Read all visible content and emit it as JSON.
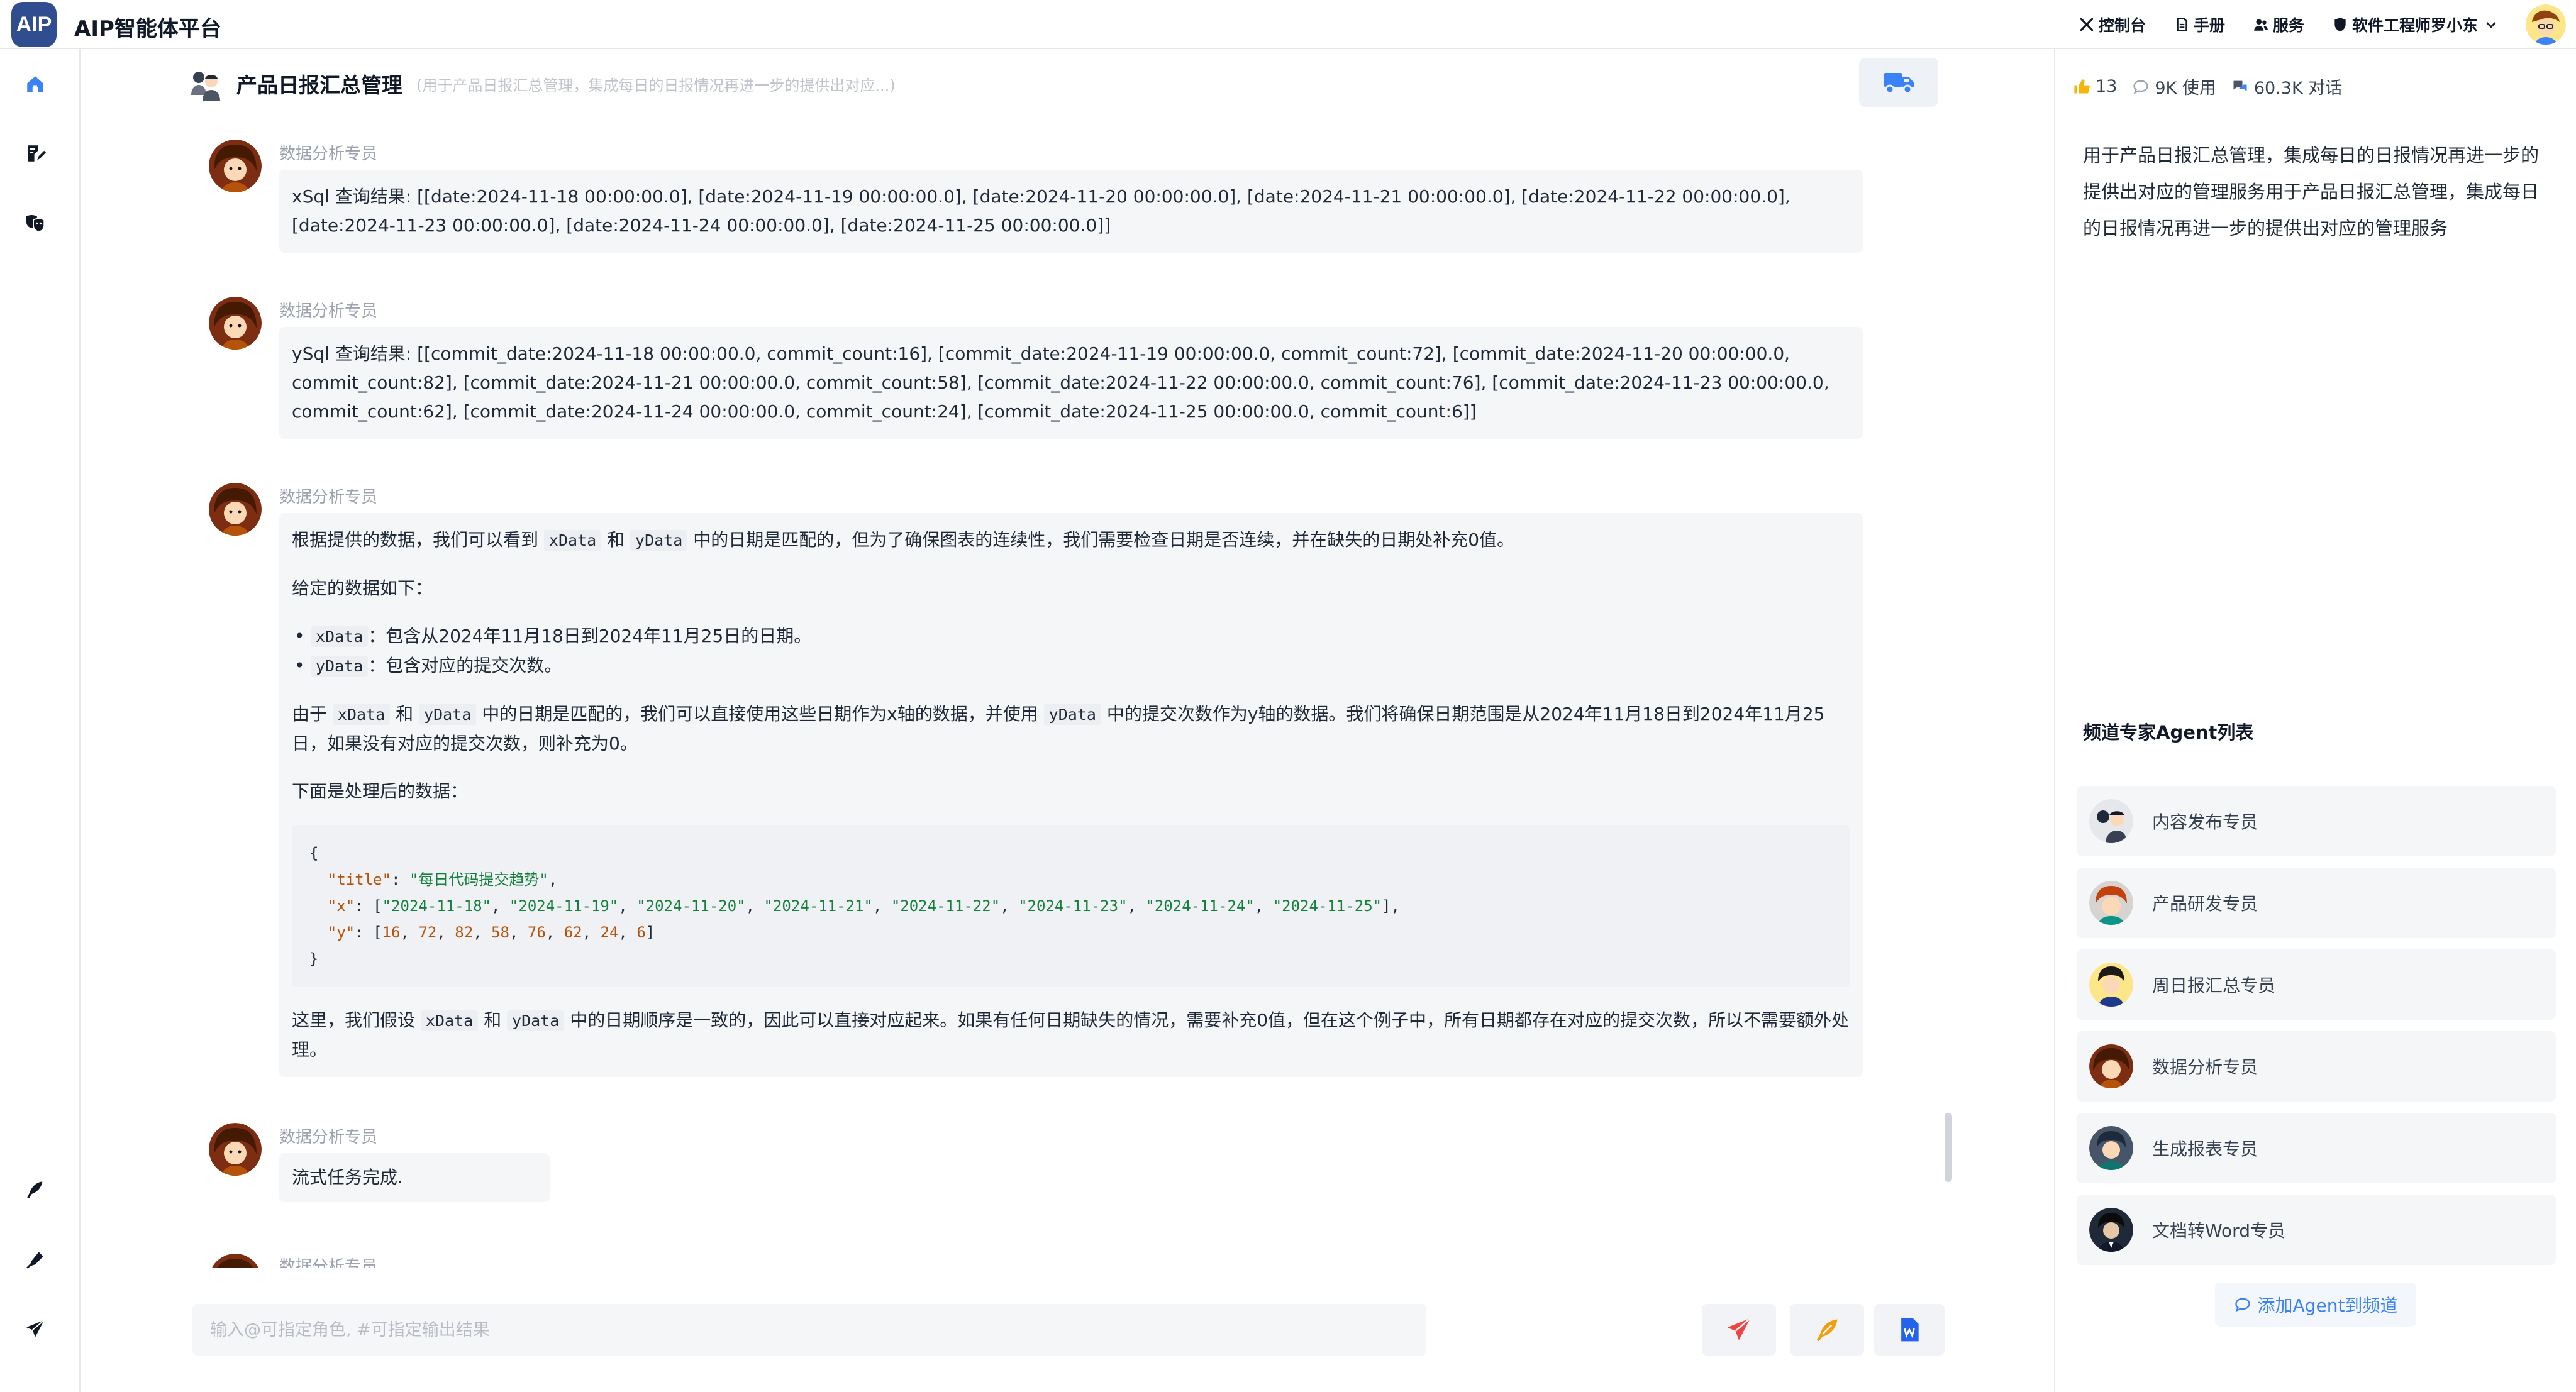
{
  "app": {
    "logo_text": "AIP",
    "title": "AIP智能体平台"
  },
  "topnav": {
    "console": "控制台",
    "manual": "手册",
    "service": "服务",
    "user": "软件工程师罗小东"
  },
  "channel": {
    "title": "产品日报汇总管理",
    "desc": "(用于产品日报汇总管理，集成每日的日报情况再进一步的提供出对应...)"
  },
  "messages": [
    {
      "sender": "数据分析专员",
      "text": "xSql 查询结果: [[date:2024-11-18 00:00:00.0], [date:2024-11-19 00:00:00.0], [date:2024-11-20 00:00:00.0], [date:2024-11-21 00:00:00.0], [date:2024-11-22 00:00:00.0], [date:2024-11-23 00:00:00.0], [date:2024-11-24 00:00:00.0], [date:2024-11-25 00:00:00.0]]"
    },
    {
      "sender": "数据分析专员",
      "text": "ySql 查询结果: [[commit_date:2024-11-18 00:00:00.0, commit_count:16], [commit_date:2024-11-19 00:00:00.0, commit_count:72], [commit_date:2024-11-20 00:00:00.0, commit_count:82], [commit_date:2024-11-21 00:00:00.0, commit_count:58], [commit_date:2024-11-22 00:00:00.0, commit_count:76], [commit_date:2024-11-23 00:00:00.0, commit_count:62], [commit_date:2024-11-24 00:00:00.0, commit_count:24], [commit_date:2024-11-25 00:00:00.0, commit_count:6]]"
    },
    {
      "sender": "数据分析专员",
      "p1_a": "根据提供的数据，我们可以看到",
      "p1_b": "和",
      "p1_c": "中的日期是匹配的，但为了确保图表的连续性，我们需要检查日期是否连续，并在缺失的日期处补充0值。",
      "p2": "给定的数据如下：",
      "li1": "：包含从2024年11月18日到2024年11月25日的日期。",
      "li2": "：包含对应的提交次数。",
      "p3_a": "由于",
      "p3_b": "和",
      "p3_c": "中的日期是匹配的，我们可以直接使用这些日期作为x轴的数据，并使用",
      "p3_d": "中的提交次数作为y轴的数据。我们将确保日期范围是从2024年11月18日到2024年11月25日，如果没有对应的提交次数，则补充为0。",
      "p4": "下面是处理后的数据：",
      "p5_a": "这里，我们假设",
      "p5_b": "和",
      "p5_c": "中的日期顺序是一致的，因此可以直接对应起来。如果有任何日期缺失的情况，需要补充0值，但在这个例子中，所有日期都存在对应的提交次数，所以不需要额外处理。",
      "xdata": "xData",
      "ydata": "yData",
      "code": {
        "title_key": "\"title\"",
        "title_val": "\"每日代码提交趋势\"",
        "x_key": "\"x\"",
        "x_vals": [
          "\"2024-11-18\"",
          "\"2024-11-19\"",
          "\"2024-11-20\"",
          "\"2024-11-21\"",
          "\"2024-11-22\"",
          "\"2024-11-23\"",
          "\"2024-11-24\"",
          "\"2024-11-25\""
        ],
        "y_key": "\"y\"",
        "y_vals": [
          "16",
          "72",
          "82",
          "58",
          "76",
          "62",
          "24",
          "6"
        ]
      }
    },
    {
      "sender": "数据分析专员",
      "text": "流式任务完成."
    },
    {
      "sender": "数据分析专员"
    }
  ],
  "input": {
    "placeholder": "输入@可指定角色, #可指定输出结果",
    "value": ""
  },
  "panel": {
    "likes": "13",
    "uses": "9K 使用",
    "chats": "60.3K 对话",
    "description": "用于产品日报汇总管理，集成每日的日报情况再进一步的提供出对应的管理服务用于产品日报汇总管理，集成每日的日报情况再进一步的提供出对应的管理服务",
    "agents_title": "频道专家Agent列表",
    "agents": [
      {
        "name": "内容发布专员"
      },
      {
        "name": "产品研发专员"
      },
      {
        "name": "周日报汇总专员"
      },
      {
        "name": "数据分析专员"
      },
      {
        "name": "生成报表专员"
      },
      {
        "name": "文档转Word专员"
      }
    ],
    "add_agent": "添加Agent到频道"
  },
  "colors": {
    "accent": "#3b82f6",
    "send": "#ef4444",
    "feather": "#f59e0b",
    "word": "#2563eb",
    "logo_bg": "#2f4d8f"
  }
}
